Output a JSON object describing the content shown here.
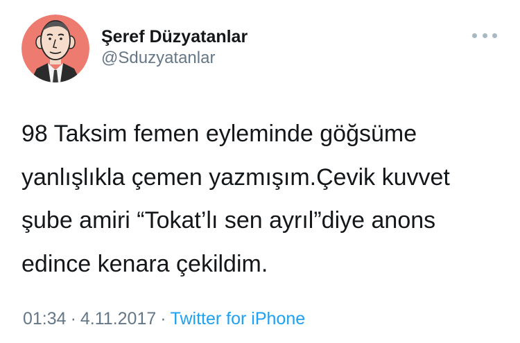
{
  "user": {
    "display_name": "Şeref Düzyatanlar",
    "handle": "@Sduzyatanlar",
    "avatar_icon": "caricature-avatar-icon",
    "avatar_bg": "#ee7b6f"
  },
  "tweet": {
    "text": "98 Taksim femen eyleminde göğsüme\nyanlışlıkla çemen yazmışım.Çevik kuvvet\nşube amiri “Tokat’lı sen ayrıl”diye anons\nedince kenara çekildim.",
    "time": "01:34",
    "date": "4.11.2017",
    "separator": "·",
    "source": "Twitter for iPhone"
  },
  "more_icon": "more-dots-icon",
  "colors": {
    "text": "#14171a",
    "secondary": "#657786",
    "link": "#1da1f2"
  }
}
